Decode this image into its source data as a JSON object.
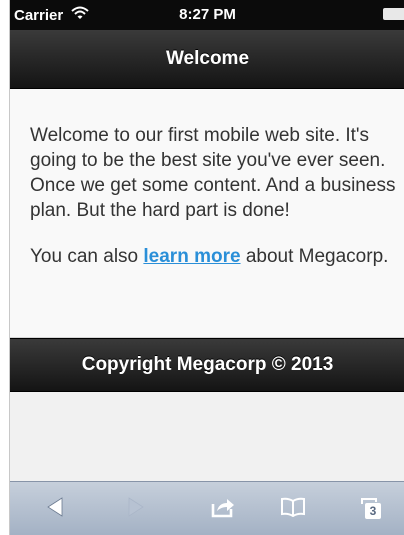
{
  "status_bar": {
    "carrier": "Carrier",
    "time": "8:27 PM"
  },
  "header": {
    "title": "Welcome"
  },
  "content": {
    "intro": "Welcome to our first mobile web site. It's going to be the best site you've ever seen. Once we get some content. And a business plan. But the hard part is done!",
    "learn_before": "You can also ",
    "learn_link": "learn more",
    "learn_after": " about Megacorp."
  },
  "footer": {
    "text": "Copyright Megacorp © 2013"
  },
  "toolbar": {
    "tab_count": "3",
    "icons": [
      "back-icon",
      "forward-icon",
      "share-icon",
      "bookmarks-icon",
      "tabs-icon"
    ]
  }
}
